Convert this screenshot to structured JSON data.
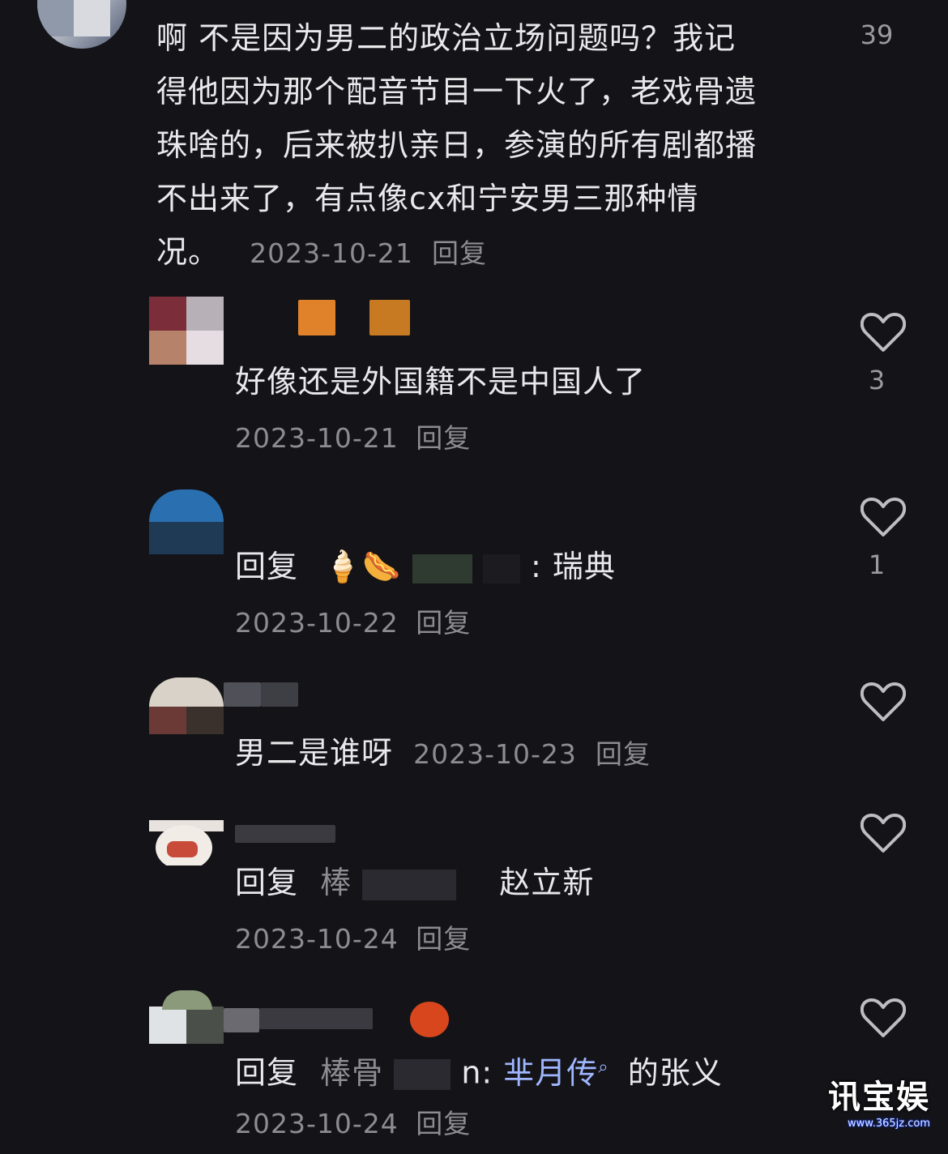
{
  "top_comment": {
    "lines": [
      "啊  不是因为男二的政治立场问题吗？我记",
      "得他因为那个配音节目一下火了，老戏骨遗",
      "珠啥的，后来被扒亲日，参演的所有剧都播",
      "不出来了，有点像cx和宁安男三那种情"
    ],
    "last_line": "况。",
    "date": "2023-10-21",
    "reply_label": "回复",
    "likes": "39"
  },
  "replies": [
    {
      "text": "好像还是外国籍不是中国人了",
      "date": "2023-10-21",
      "reply_label": "回复",
      "likes": "3"
    },
    {
      "reply_prefix": "回复",
      "reply_target": ": 瑞典",
      "emoji": "🍦🌭",
      "date": "2023-10-22",
      "reply_label": "回复",
      "likes": "1"
    },
    {
      "text": "男二是谁呀",
      "date": "2023-10-23",
      "reply_label": "回复",
      "likes": ""
    },
    {
      "reply_prefix": "回复",
      "reply_target_start": "棒",
      "reply_target_end": "赵立新",
      "date": "2023-10-24",
      "reply_label": "回复",
      "likes": ""
    },
    {
      "reply_prefix": "回复",
      "reply_target_start": "棒骨",
      "reply_target_mid": "n: ",
      "reply_target_end": "芈月传",
      "reply_suffix": "的张义",
      "date": "2023-10-24",
      "reply_label": "回复",
      "likes": ""
    }
  ],
  "watermark": {
    "brand": "讯宝娱",
    "url": "www.365jz.com"
  },
  "icons": {
    "like": "heart-outline-icon",
    "search": "search-icon"
  },
  "colors": {
    "background": "#141418",
    "text": "#e9e9eb",
    "meta": "#8c8c92"
  }
}
